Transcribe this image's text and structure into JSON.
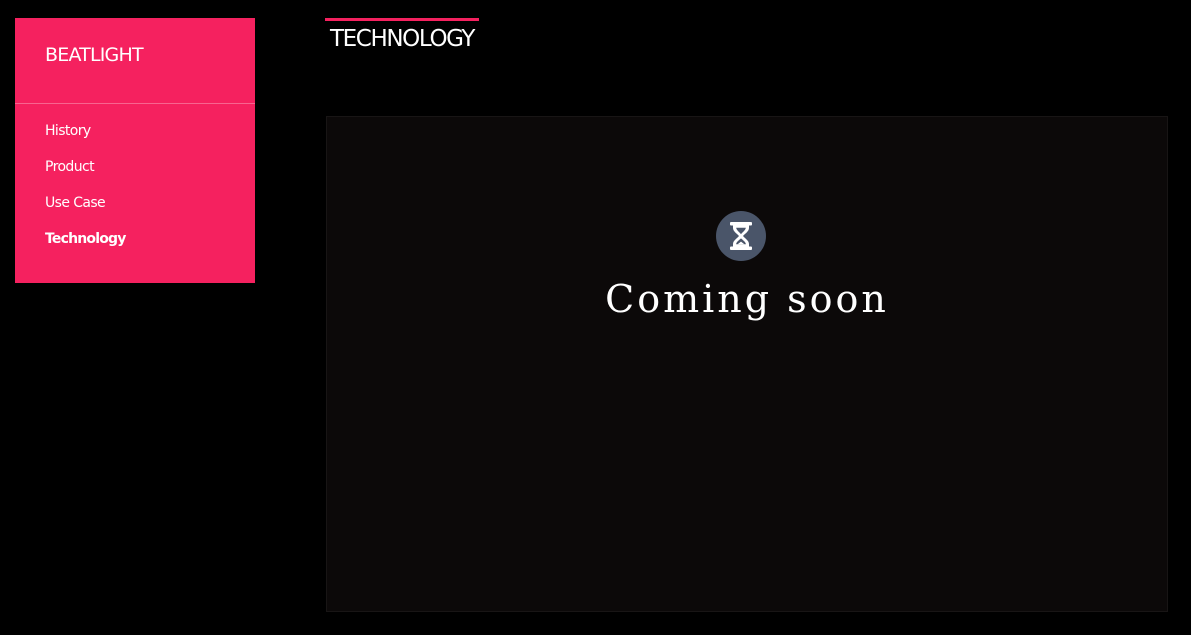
{
  "sidebar": {
    "brand": "BEATLIGHT",
    "items": [
      {
        "label": "History"
      },
      {
        "label": "Product"
      },
      {
        "label": "Use Case"
      },
      {
        "label": "Technology"
      }
    ],
    "active_item": "Technology"
  },
  "header": {
    "title": "TECHNOLOGY"
  },
  "main": {
    "status_icon": "hourglass-icon",
    "message": "Coming soon"
  },
  "colors": {
    "accent": "#f5215f",
    "background": "#000000",
    "panel": "#0c0909",
    "icon_badge": "#4a5569"
  }
}
